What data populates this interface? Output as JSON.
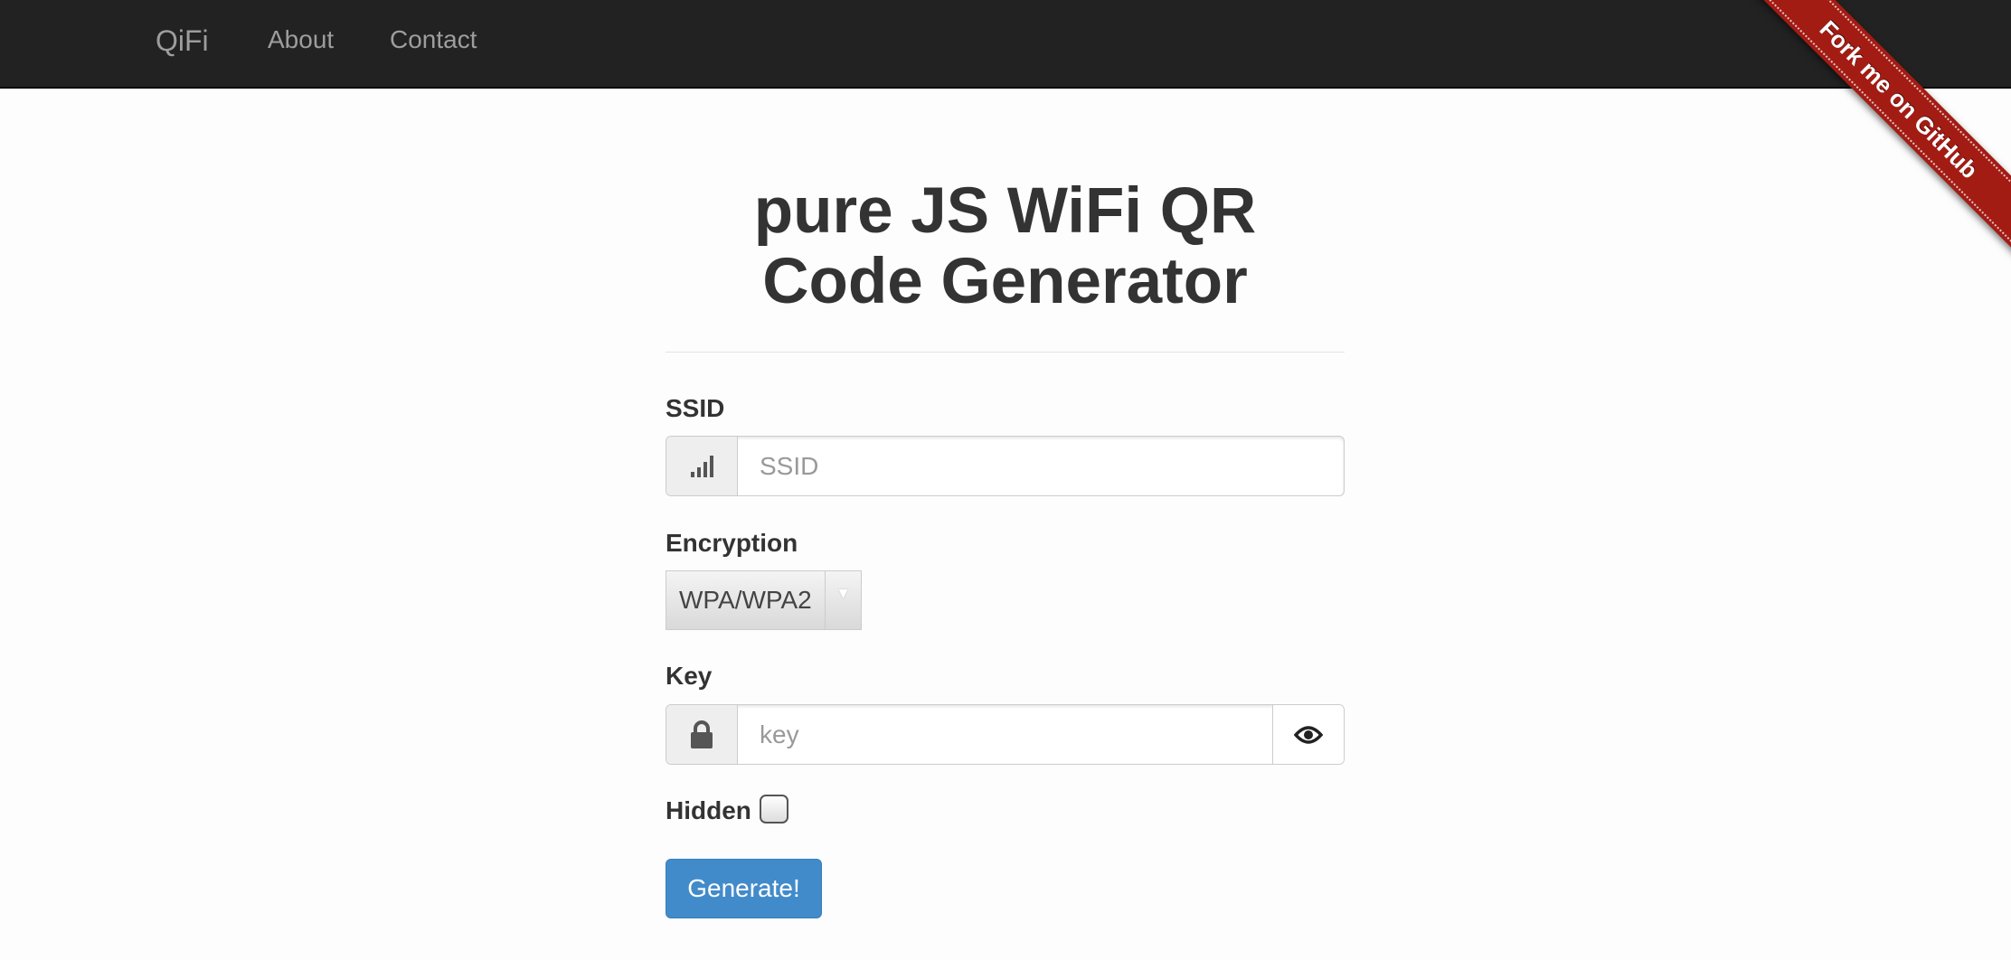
{
  "navbar": {
    "brand": "QiFi",
    "links": [
      "About",
      "Contact"
    ]
  },
  "ribbon": {
    "label": "Fork me on GitHub",
    "color": "#a31c14"
  },
  "page": {
    "title": "pure JS WiFi QR Code Generator"
  },
  "form": {
    "ssid": {
      "label": "SSID",
      "placeholder": "SSID",
      "value": "",
      "icon": "signal-icon"
    },
    "encryption": {
      "label": "Encryption",
      "selected": "WPA/WPA2"
    },
    "key": {
      "label": "Key",
      "placeholder": "key",
      "value": "",
      "icon": "lock-icon",
      "toggle_icon": "eye-icon"
    },
    "hidden": {
      "label": "Hidden",
      "checked": false
    },
    "submit_label": "Generate!",
    "accent": "#428bca"
  }
}
